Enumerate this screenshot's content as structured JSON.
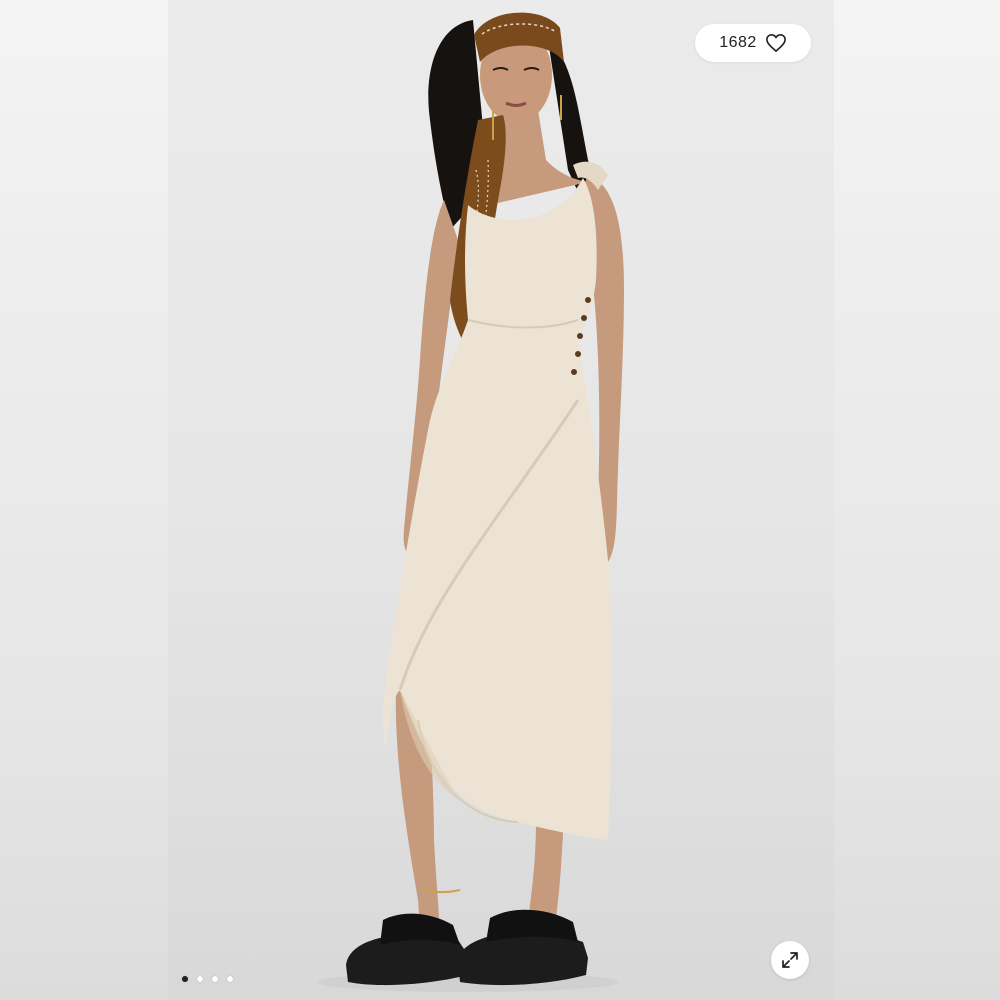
{
  "listing": {
    "like_count": "1682",
    "like_icon": "heart-outline-icon",
    "expand_icon": "expand-arrows-icon",
    "image_count": 4,
    "active_image_index": 0
  },
  "colors": {
    "background": "#e6e6e6",
    "dress": "#ede3d4",
    "scarf": "#7a4a1c",
    "sandal": "#1c1c1c",
    "active_dot": "#222222"
  }
}
